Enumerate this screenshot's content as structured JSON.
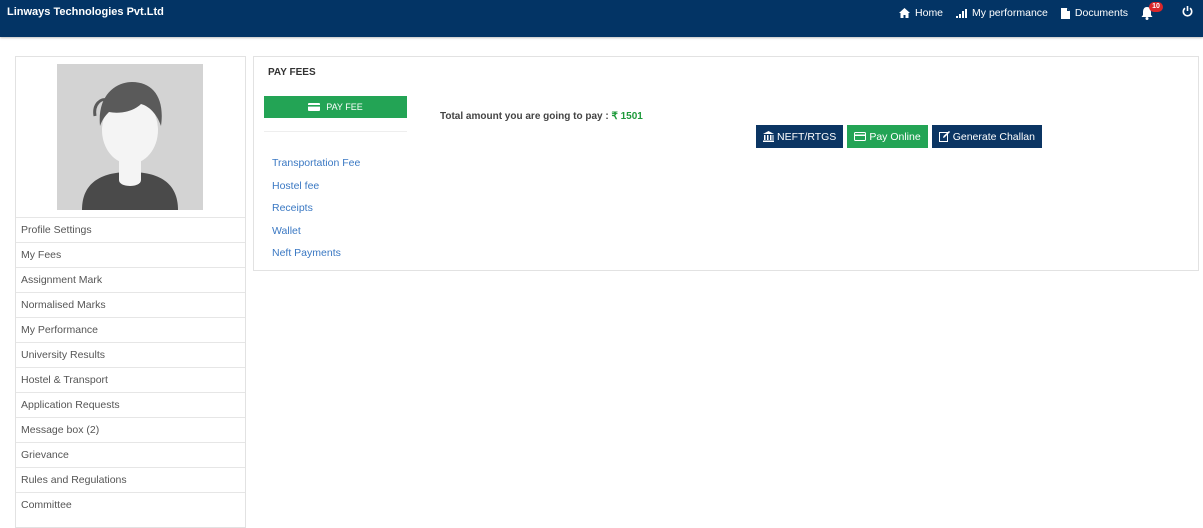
{
  "header": {
    "brand": "Linways Technologies Pvt.Ltd",
    "nav": {
      "home": "Home",
      "performance": "My performance",
      "documents": "Documents"
    },
    "notification_count": "10",
    "bg_color": "#033465"
  },
  "sidebar": {
    "items": [
      "Profile Settings",
      "My Fees",
      "Assignment Mark",
      "Normalised Marks",
      "My Performance",
      "University Results",
      "Hostel & Transport",
      "Application Requests",
      "Message box (2)",
      "Grievance",
      "Rules and Regulations",
      "Committee"
    ]
  },
  "panel": {
    "title": "PAY FEES",
    "pay_fee_button": "PAY FEE",
    "links": [
      "Transportation Fee",
      "Hostel fee",
      "Receipts",
      "Wallet",
      "Neft Payments"
    ],
    "total_label": "Total amount you are going to pay : ",
    "total_amount": "₹ 1501",
    "buttons": {
      "neft": "NEFT/RTGS",
      "pay_online": "Pay Online",
      "challan": "Generate Challan"
    }
  },
  "colors": {
    "accent_green": "#23a455",
    "dark_blue": "#0b3563",
    "link_blue": "#3a78c3"
  }
}
